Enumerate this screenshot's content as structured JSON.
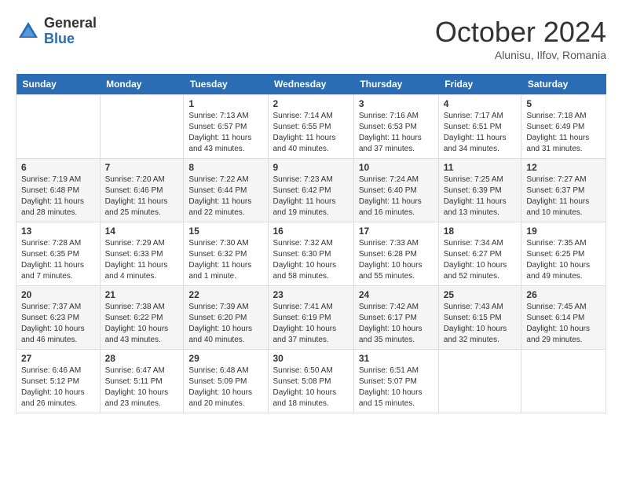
{
  "logo": {
    "general": "General",
    "blue": "Blue"
  },
  "title": "October 2024",
  "location": "Alunisu, Ilfov, Romania",
  "days_of_week": [
    "Sunday",
    "Monday",
    "Tuesday",
    "Wednesday",
    "Thursday",
    "Friday",
    "Saturday"
  ],
  "weeks": [
    [
      {
        "day": "",
        "sunrise": "",
        "sunset": "",
        "daylight": ""
      },
      {
        "day": "",
        "sunrise": "",
        "sunset": "",
        "daylight": ""
      },
      {
        "day": "1",
        "sunrise": "Sunrise: 7:13 AM",
        "sunset": "Sunset: 6:57 PM",
        "daylight": "Daylight: 11 hours and 43 minutes."
      },
      {
        "day": "2",
        "sunrise": "Sunrise: 7:14 AM",
        "sunset": "Sunset: 6:55 PM",
        "daylight": "Daylight: 11 hours and 40 minutes."
      },
      {
        "day": "3",
        "sunrise": "Sunrise: 7:16 AM",
        "sunset": "Sunset: 6:53 PM",
        "daylight": "Daylight: 11 hours and 37 minutes."
      },
      {
        "day": "4",
        "sunrise": "Sunrise: 7:17 AM",
        "sunset": "Sunset: 6:51 PM",
        "daylight": "Daylight: 11 hours and 34 minutes."
      },
      {
        "day": "5",
        "sunrise": "Sunrise: 7:18 AM",
        "sunset": "Sunset: 6:49 PM",
        "daylight": "Daylight: 11 hours and 31 minutes."
      }
    ],
    [
      {
        "day": "6",
        "sunrise": "Sunrise: 7:19 AM",
        "sunset": "Sunset: 6:48 PM",
        "daylight": "Daylight: 11 hours and 28 minutes."
      },
      {
        "day": "7",
        "sunrise": "Sunrise: 7:20 AM",
        "sunset": "Sunset: 6:46 PM",
        "daylight": "Daylight: 11 hours and 25 minutes."
      },
      {
        "day": "8",
        "sunrise": "Sunrise: 7:22 AM",
        "sunset": "Sunset: 6:44 PM",
        "daylight": "Daylight: 11 hours and 22 minutes."
      },
      {
        "day": "9",
        "sunrise": "Sunrise: 7:23 AM",
        "sunset": "Sunset: 6:42 PM",
        "daylight": "Daylight: 11 hours and 19 minutes."
      },
      {
        "day": "10",
        "sunrise": "Sunrise: 7:24 AM",
        "sunset": "Sunset: 6:40 PM",
        "daylight": "Daylight: 11 hours and 16 minutes."
      },
      {
        "day": "11",
        "sunrise": "Sunrise: 7:25 AM",
        "sunset": "Sunset: 6:39 PM",
        "daylight": "Daylight: 11 hours and 13 minutes."
      },
      {
        "day": "12",
        "sunrise": "Sunrise: 7:27 AM",
        "sunset": "Sunset: 6:37 PM",
        "daylight": "Daylight: 11 hours and 10 minutes."
      }
    ],
    [
      {
        "day": "13",
        "sunrise": "Sunrise: 7:28 AM",
        "sunset": "Sunset: 6:35 PM",
        "daylight": "Daylight: 11 hours and 7 minutes."
      },
      {
        "day": "14",
        "sunrise": "Sunrise: 7:29 AM",
        "sunset": "Sunset: 6:33 PM",
        "daylight": "Daylight: 11 hours and 4 minutes."
      },
      {
        "day": "15",
        "sunrise": "Sunrise: 7:30 AM",
        "sunset": "Sunset: 6:32 PM",
        "daylight": "Daylight: 11 hours and 1 minute."
      },
      {
        "day": "16",
        "sunrise": "Sunrise: 7:32 AM",
        "sunset": "Sunset: 6:30 PM",
        "daylight": "Daylight: 10 hours and 58 minutes."
      },
      {
        "day": "17",
        "sunrise": "Sunrise: 7:33 AM",
        "sunset": "Sunset: 6:28 PM",
        "daylight": "Daylight: 10 hours and 55 minutes."
      },
      {
        "day": "18",
        "sunrise": "Sunrise: 7:34 AM",
        "sunset": "Sunset: 6:27 PM",
        "daylight": "Daylight: 10 hours and 52 minutes."
      },
      {
        "day": "19",
        "sunrise": "Sunrise: 7:35 AM",
        "sunset": "Sunset: 6:25 PM",
        "daylight": "Daylight: 10 hours and 49 minutes."
      }
    ],
    [
      {
        "day": "20",
        "sunrise": "Sunrise: 7:37 AM",
        "sunset": "Sunset: 6:23 PM",
        "daylight": "Daylight: 10 hours and 46 minutes."
      },
      {
        "day": "21",
        "sunrise": "Sunrise: 7:38 AM",
        "sunset": "Sunset: 6:22 PM",
        "daylight": "Daylight: 10 hours and 43 minutes."
      },
      {
        "day": "22",
        "sunrise": "Sunrise: 7:39 AM",
        "sunset": "Sunset: 6:20 PM",
        "daylight": "Daylight: 10 hours and 40 minutes."
      },
      {
        "day": "23",
        "sunrise": "Sunrise: 7:41 AM",
        "sunset": "Sunset: 6:19 PM",
        "daylight": "Daylight: 10 hours and 37 minutes."
      },
      {
        "day": "24",
        "sunrise": "Sunrise: 7:42 AM",
        "sunset": "Sunset: 6:17 PM",
        "daylight": "Daylight: 10 hours and 35 minutes."
      },
      {
        "day": "25",
        "sunrise": "Sunrise: 7:43 AM",
        "sunset": "Sunset: 6:15 PM",
        "daylight": "Daylight: 10 hours and 32 minutes."
      },
      {
        "day": "26",
        "sunrise": "Sunrise: 7:45 AM",
        "sunset": "Sunset: 6:14 PM",
        "daylight": "Daylight: 10 hours and 29 minutes."
      }
    ],
    [
      {
        "day": "27",
        "sunrise": "Sunrise: 6:46 AM",
        "sunset": "Sunset: 5:12 PM",
        "daylight": "Daylight: 10 hours and 26 minutes."
      },
      {
        "day": "28",
        "sunrise": "Sunrise: 6:47 AM",
        "sunset": "Sunset: 5:11 PM",
        "daylight": "Daylight: 10 hours and 23 minutes."
      },
      {
        "day": "29",
        "sunrise": "Sunrise: 6:48 AM",
        "sunset": "Sunset: 5:09 PM",
        "daylight": "Daylight: 10 hours and 20 minutes."
      },
      {
        "day": "30",
        "sunrise": "Sunrise: 6:50 AM",
        "sunset": "Sunset: 5:08 PM",
        "daylight": "Daylight: 10 hours and 18 minutes."
      },
      {
        "day": "31",
        "sunrise": "Sunrise: 6:51 AM",
        "sunset": "Sunset: 5:07 PM",
        "daylight": "Daylight: 10 hours and 15 minutes."
      },
      {
        "day": "",
        "sunrise": "",
        "sunset": "",
        "daylight": ""
      },
      {
        "day": "",
        "sunrise": "",
        "sunset": "",
        "daylight": ""
      }
    ]
  ]
}
